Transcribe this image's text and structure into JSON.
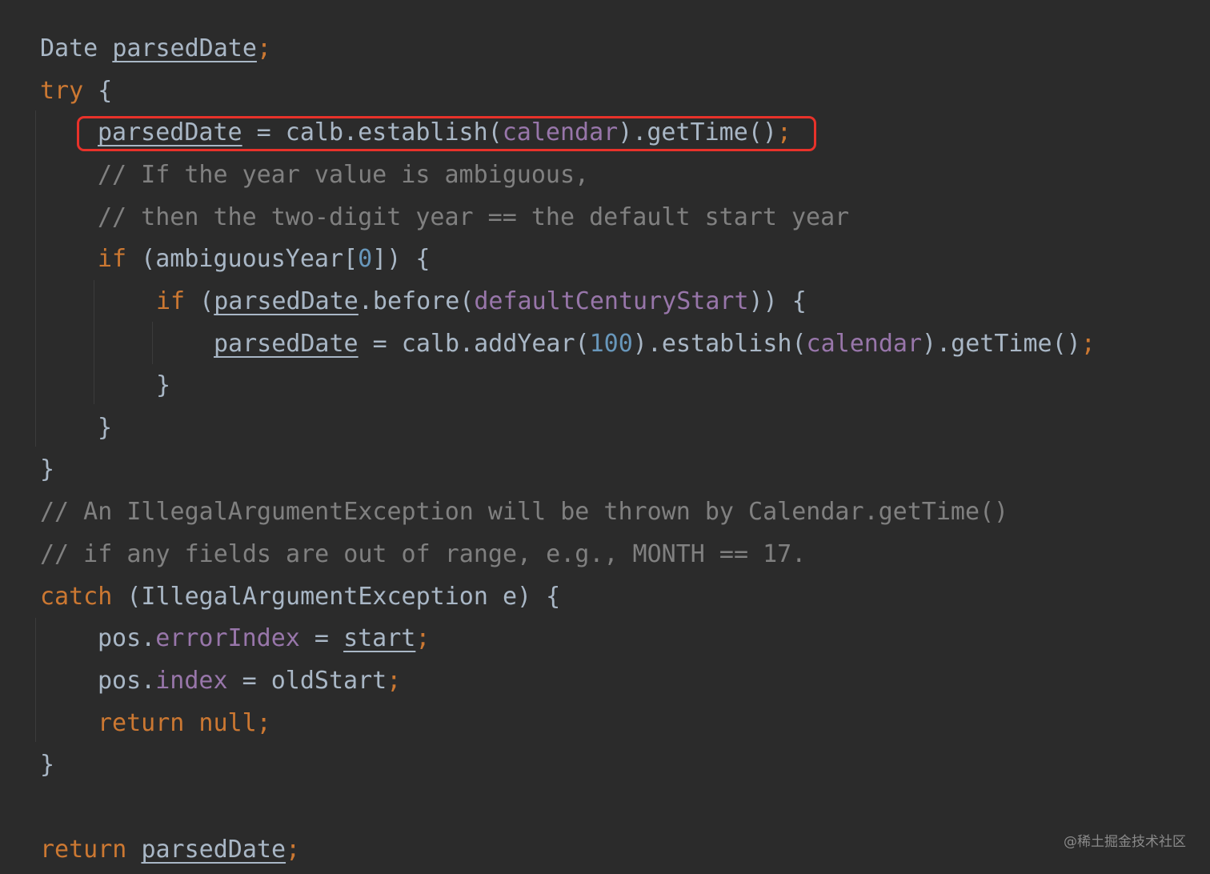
{
  "editor": {
    "lines": [
      {
        "tokens": [
          {
            "t": "Date ",
            "c": "plain"
          },
          {
            "t": "parsedDate",
            "c": "var"
          },
          {
            "t": ";",
            "c": "semi"
          }
        ]
      },
      {
        "tokens": [
          {
            "t": "try",
            "c": "kw"
          },
          {
            "t": " {",
            "c": "plain"
          }
        ]
      },
      {
        "tokens": [
          {
            "t": "parsedDate",
            "c": "var"
          },
          {
            "t": " = calb.establish(",
            "c": "plain"
          },
          {
            "t": "calendar",
            "c": "field"
          },
          {
            "t": ").getTime()",
            "c": "plain"
          },
          {
            "t": ";",
            "c": "semi"
          }
        ]
      },
      {
        "tokens": [
          {
            "t": "// If the year value is ambiguous,",
            "c": "comment"
          }
        ]
      },
      {
        "tokens": [
          {
            "t": "// then the two-digit year == the default start year",
            "c": "comment"
          }
        ]
      },
      {
        "tokens": [
          {
            "t": "if",
            "c": "kw"
          },
          {
            "t": " (ambiguousYear[",
            "c": "plain"
          },
          {
            "t": "0",
            "c": "num"
          },
          {
            "t": "]) {",
            "c": "plain"
          }
        ]
      },
      {
        "tokens": [
          {
            "t": "if",
            "c": "kw"
          },
          {
            "t": " (",
            "c": "plain"
          },
          {
            "t": "parsedDate",
            "c": "var"
          },
          {
            "t": ".before(",
            "c": "plain"
          },
          {
            "t": "defaultCenturyStart",
            "c": "field"
          },
          {
            "t": ")) {",
            "c": "plain"
          }
        ]
      },
      {
        "tokens": [
          {
            "t": "parsedDate",
            "c": "var"
          },
          {
            "t": " = calb.addYear(",
            "c": "plain"
          },
          {
            "t": "100",
            "c": "num"
          },
          {
            "t": ").establish(",
            "c": "plain"
          },
          {
            "t": "calendar",
            "c": "field"
          },
          {
            "t": ").getTime()",
            "c": "plain"
          },
          {
            "t": ";",
            "c": "semi"
          }
        ]
      },
      {
        "tokens": [
          {
            "t": "}",
            "c": "plain"
          }
        ]
      },
      {
        "tokens": [
          {
            "t": "}",
            "c": "plain"
          }
        ]
      },
      {
        "tokens": [
          {
            "t": "}",
            "c": "plain"
          }
        ]
      },
      {
        "tokens": [
          {
            "t": "// An IllegalArgumentException will be thrown by Calendar.getTime()",
            "c": "comment"
          }
        ]
      },
      {
        "tokens": [
          {
            "t": "// if any fields are out of range, e.g., MONTH == 17.",
            "c": "comment"
          }
        ]
      },
      {
        "tokens": [
          {
            "t": "catch",
            "c": "kw"
          },
          {
            "t": " (IllegalArgumentException e) {",
            "c": "plain"
          }
        ]
      },
      {
        "tokens": [
          {
            "t": "pos.",
            "c": "plain"
          },
          {
            "t": "errorIndex",
            "c": "field"
          },
          {
            "t": " = ",
            "c": "plain"
          },
          {
            "t": "start",
            "c": "var"
          },
          {
            "t": ";",
            "c": "semi"
          }
        ]
      },
      {
        "tokens": [
          {
            "t": "pos.",
            "c": "plain"
          },
          {
            "t": "index",
            "c": "field"
          },
          {
            "t": " = oldStart",
            "c": "plain"
          },
          {
            "t": ";",
            "c": "semi"
          }
        ]
      },
      {
        "tokens": [
          {
            "t": "return null;",
            "c": "kw"
          }
        ]
      },
      {
        "tokens": [
          {
            "t": "}",
            "c": "plain"
          }
        ]
      },
      {
        "tokens": []
      },
      {
        "tokens": [
          {
            "t": "return",
            "c": "kw"
          },
          {
            "t": " ",
            "c": "plain"
          },
          {
            "t": "parsedDate",
            "c": "var"
          },
          {
            "t": ";",
            "c": "semi"
          }
        ]
      }
    ]
  },
  "watermark": "@稀土掘金技术社区",
  "colors": {
    "background": "#2b2b2b",
    "keyword": "#cc7832",
    "comment": "#808080",
    "field": "#9876aa",
    "number": "#6897bb",
    "plain": "#a9b7c6",
    "highlight_box": "#e8322a"
  }
}
